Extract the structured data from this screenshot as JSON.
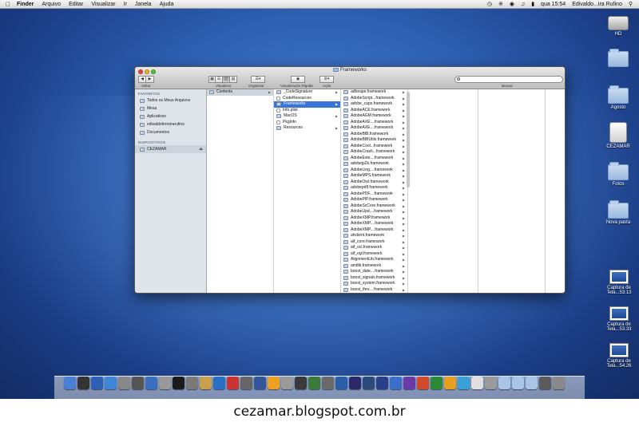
{
  "menubar": {
    "finder": "Finder",
    "items": [
      "Arquivo",
      "Editar",
      "Visualizar",
      "Ir",
      "Janela",
      "Ajuda"
    ],
    "clock": "qua 15:54",
    "user": "Edivaldo...ira Rufino"
  },
  "window": {
    "title": "Frameworks",
    "toolbar": {
      "back_label": "Voltar",
      "view_label": "Visualizar",
      "arrange_label": "Organizar",
      "quicklook_label": "Visualização Rápida",
      "action_label": "Ação",
      "search_label": "Buscar"
    },
    "sidebar": {
      "favorites_header": "FAVORITOS",
      "favorites": [
        "Todos os Meus Arquivos",
        "Mesa",
        "Aplicativos",
        "edivaldoferreirarufino",
        "Documentos"
      ],
      "devices_header": "DISPOSITIVOS",
      "devices": [
        "CEZAMAR"
      ]
    },
    "columns": {
      "col1": [
        "Contents"
      ],
      "col2": [
        "_CodeSignature",
        "CodeResources",
        "Frameworks",
        "Info.plist",
        "MacOS",
        "PkgInfo",
        "Resources"
      ],
      "col3": [
        "adbeape.framework",
        "AdobeScript...framework",
        "adobe_caps.framework",
        "AdobeACE.framework",
        "AdobeAGM.framework",
        "AdobeAXE....framework",
        "AdobeAXE....framework",
        "AdobeBIB.framework",
        "AdobeBIBUtils.framework",
        "AdobeCool...framework",
        "AdobeCrash...framework",
        "AdobeExte....framework",
        "adobejp2k.framework",
        "AdobeLing....framework",
        "AdobeMPS.framework",
        "AdobeOwl.framework",
        "adobepdfl.framework",
        "AdobePDF....framework",
        "AdobePIP.framework",
        "AdobeScCore.framework",
        "AdobeUpd....framework",
        "AdobeXMP.framework",
        "AdobeXMP....framework",
        "AdobeXMP....framework",
        "ahclient.framework",
        "aif_core.framework",
        "aif_ocl.framework",
        "aif_ogl.framework",
        "AlignmentLib.framework",
        "amtlib.framework",
        "boost_date....framework",
        "boost_signals.framework",
        "boost_system.framework",
        "boost_thre....framework"
      ]
    }
  },
  "desktop_icons": [
    {
      "label": "HD",
      "kind": "drive"
    },
    {
      "label": "",
      "kind": "folder"
    },
    {
      "label": "Agosto",
      "kind": "folder"
    },
    {
      "label": "CEZAMAR",
      "kind": "disk"
    },
    {
      "label": "Fotos",
      "kind": "folder"
    },
    {
      "label": "Nova pasta",
      "kind": "folder"
    },
    {
      "label": "Captura de Tela...53.13",
      "kind": "screenshot"
    },
    {
      "label": "Captura de Tela...53.33",
      "kind": "screenshot"
    },
    {
      "label": "Captura de Tela...54.26",
      "kind": "screenshot"
    }
  ],
  "dock": {
    "icons": [
      "finder-icon",
      "dashboard-icon",
      "app-icon",
      "safari-icon",
      "app-icon",
      "app-icon",
      "preview-icon",
      "app-icon",
      "app-icon",
      "app-icon",
      "app-icon",
      "app-icon",
      "app-icon",
      "app-icon",
      "app-icon",
      "app-icon",
      "app-icon",
      "app-icon",
      "app-icon",
      "app-icon",
      "app-icon",
      "app-icon",
      "lightroom-icon",
      "photoshop-icon",
      "word-icon",
      "app-icon",
      "powerpoint-icon",
      "excel-icon",
      "outlook-icon",
      "messenger-icon",
      "app-icon",
      "app-icon",
      "folder-icon",
      "folder-icon",
      "folder-icon",
      "folder-icon",
      "trash-icon"
    ],
    "colors": [
      "#4a7fd6",
      "#333333",
      "#2b5fb8",
      "#3d86d8",
      "#888888",
      "#555555",
      "#3a6fc0",
      "#999999",
      "#1b1b1b",
      "#7a7a7a",
      "#c9a04b",
      "#2a6fc4",
      "#cc3333",
      "#666666",
      "#335599",
      "#f0a020",
      "#9a9a9a",
      "#3a3a3a",
      "#3c7a3c",
      "#6a6a6a",
      "#2a5ca8",
      "#2a2a6a",
      "#2a4b7a",
      "#2a3f8a",
      "#3a6ec8",
      "#6a3aa8",
      "#d24a2a",
      "#2a8a3a",
      "#e6a020",
      "#3aa0d8",
      "#e0e0e0",
      "#9a9a9a",
      "#a8c4e6",
      "#a8c4e6",
      "#a8c4e6",
      "#5a5a5a",
      "#8a8a8a"
    ]
  },
  "caption": "cezamar.blogspot.com.br"
}
